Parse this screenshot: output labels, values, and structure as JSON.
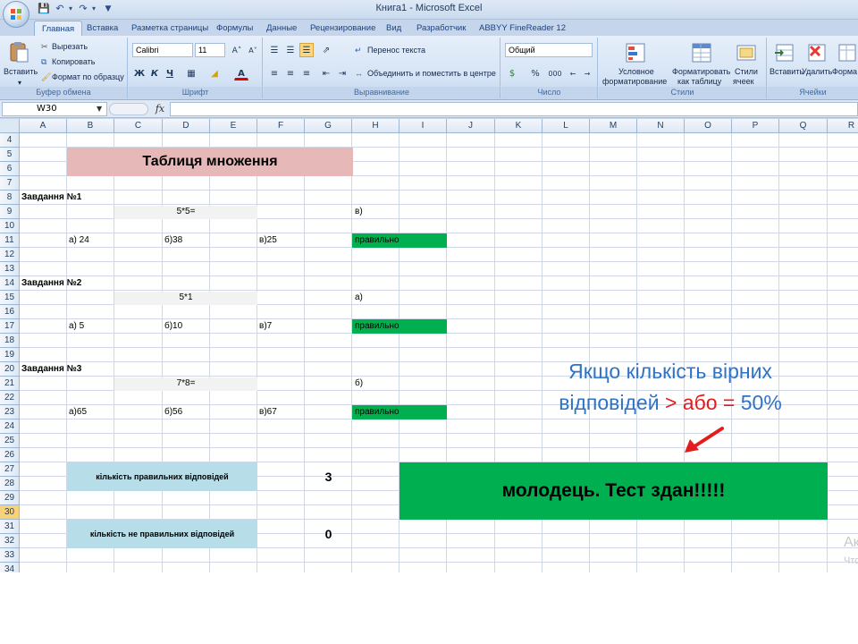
{
  "window": {
    "title": "Книга1 - Microsoft Excel",
    "qat": [
      "save",
      "undo",
      "redo",
      "customize"
    ]
  },
  "tabs": [
    "Главная",
    "Вставка",
    "Разметка страницы",
    "Формулы",
    "Данные",
    "Рецензирование",
    "Вид",
    "Разработчик",
    "ABBYY FineReader 12"
  ],
  "ribbon": {
    "clipboard": {
      "paste": "Вставить",
      "cut": "Вырезать",
      "copy": "Копировать",
      "format_painter": "Формат по образцу",
      "label": "Буфер обмена"
    },
    "font": {
      "name": "Calibri",
      "size": "11",
      "bold": "Ж",
      "italic": "К",
      "underline": "Ч",
      "grow": "A˄",
      "shrink": "A˅",
      "font_color_letter": "A",
      "label": "Шрифт"
    },
    "alignment": {
      "wrap": "Перенос текста",
      "merge": "Объединить и поместить в центре",
      "label": "Выравнивание"
    },
    "number": {
      "format": "Общий",
      "percent": "%",
      "thousands": "000",
      "label": "Число"
    },
    "styles": {
      "conditional": "Условное",
      "conditional2": "форматирование",
      "as_table": "Форматировать",
      "as_table2": "как таблицу",
      "cell_styles": "Стили",
      "cell_styles2": "ячеек",
      "label": "Стили"
    },
    "cells": {
      "insert": "Вставить",
      "delete": "Удалить",
      "format": "Форма",
      "label": "Ячейки"
    }
  },
  "formula_bar": {
    "name_box": "W30",
    "fx": "fx",
    "formula": ""
  },
  "columns": [
    "A",
    "B",
    "C",
    "D",
    "E",
    "F",
    "G",
    "H",
    "I",
    "J",
    "K",
    "L",
    "M",
    "N",
    "O",
    "P",
    "Q",
    "R"
  ],
  "rows": [
    "4",
    "5",
    "6",
    "7",
    "8",
    "9",
    "10",
    "11",
    "12",
    "13",
    "14",
    "15",
    "16",
    "17",
    "18",
    "19",
    "20",
    "21",
    "22",
    "23",
    "24",
    "25",
    "26",
    "27",
    "28",
    "29",
    "30",
    "31",
    "32",
    "33",
    "34"
  ],
  "selected_row": "30",
  "sheet": {
    "title": "Таблиця множення",
    "q1": {
      "heading": "Завдання №1",
      "question": "5*5=",
      "answer": "в)",
      "opt_a": "а) 24",
      "opt_b": "б)38",
      "opt_c": "в)25",
      "result": "правильно"
    },
    "q2": {
      "heading": "Завдання №2",
      "question": "5*1",
      "answer": "а)",
      "opt_a": "а) 5",
      "opt_b": "б)10",
      "opt_c": "в)7",
      "result": "правильно"
    },
    "q3": {
      "heading": "Завдання №3",
      "question": "7*8=",
      "answer": "б)",
      "opt_a": "а)65",
      "opt_b": "б)56",
      "opt_c": "в)67",
      "result": "правильно"
    },
    "correct_label": "кількість правильних відповідей",
    "correct_count": "3",
    "incorrect_label": "кількість не правильних відповідей",
    "incorrect_count": "0",
    "result_banner": "молодець. Тест здан!!!!!"
  },
  "callout": {
    "line1": "Якщо кількість вірних",
    "line2_blue": "відповідей ",
    "line2_red": "> або = ",
    "line2_end": "50%"
  },
  "watermark": {
    "line1": "Ак",
    "line2": "Что"
  },
  "colors": {
    "title_fill": "#e6b8b7",
    "correct_fill": "#00b050",
    "count_label_fill": "#b7dee8",
    "question_fill": "#f2f2f2",
    "banner_fill": "#00b050",
    "callout_blue": "#2f73c4",
    "callout_red": "#e51b1b",
    "arrow": "#e51b1b"
  }
}
